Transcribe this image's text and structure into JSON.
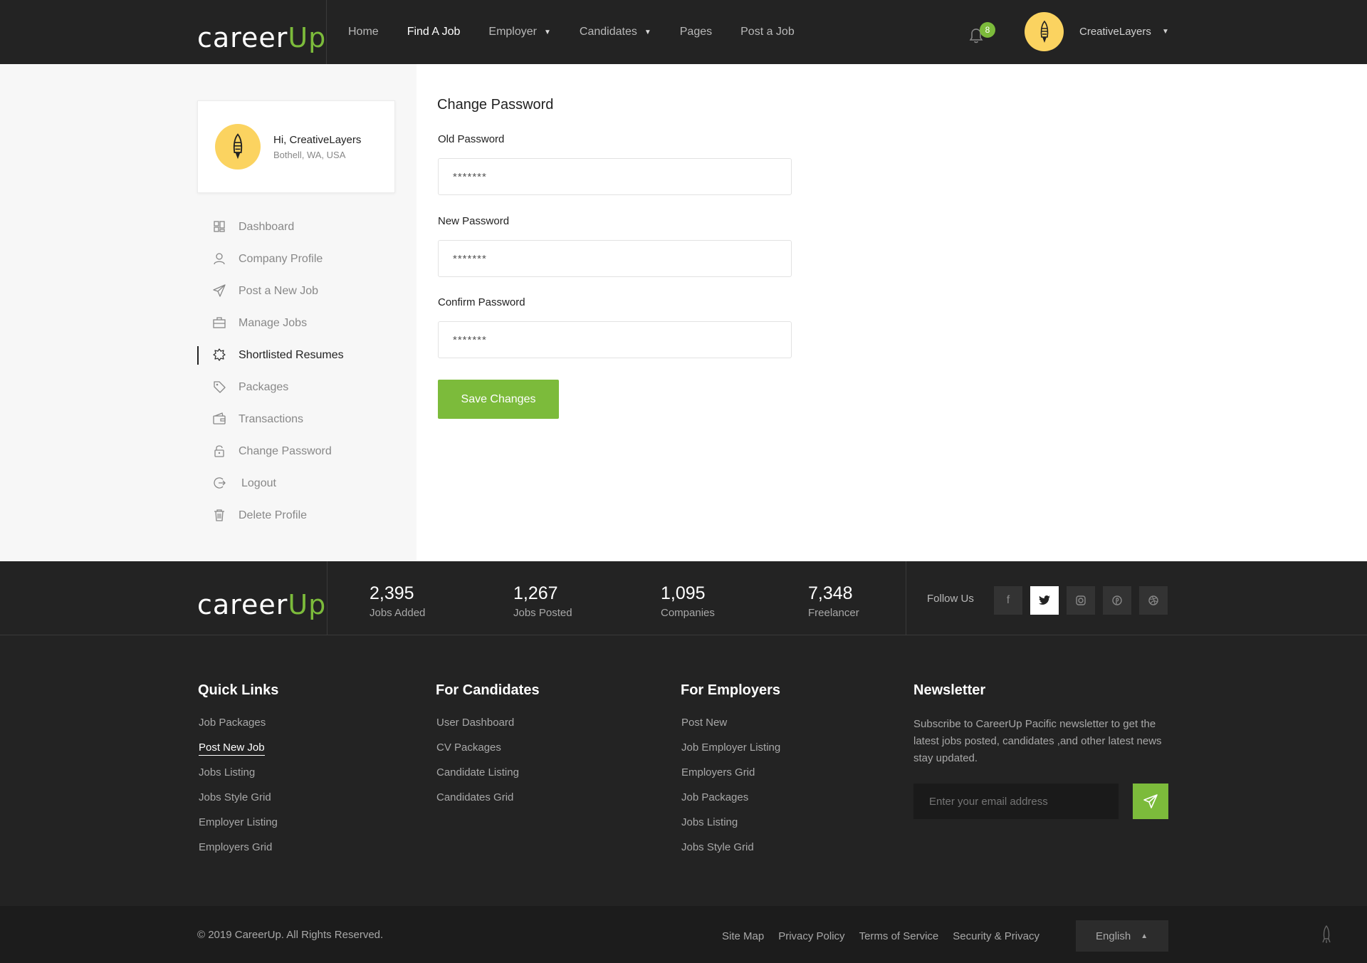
{
  "brand": {
    "name_main": "career",
    "name_accent": "Up"
  },
  "nav": {
    "items": [
      {
        "label": "Home",
        "has_caret": false
      },
      {
        "label": "Find A Job",
        "has_caret": false,
        "active": true
      },
      {
        "label": "Employer",
        "has_caret": true
      },
      {
        "label": "Candidates",
        "has_caret": true
      },
      {
        "label": "Pages",
        "has_caret": false
      },
      {
        "label": "Post a Job",
        "has_caret": false
      }
    ],
    "notification_count": "8",
    "user_name": "CreativeLayers"
  },
  "profile": {
    "greeting": "Hi, CreativeLayers",
    "location": "Bothell, WA, USA"
  },
  "sidebar": {
    "items": [
      {
        "label": "Dashboard",
        "icon": "dashboard-icon"
      },
      {
        "label": "Company Profile",
        "icon": "user-icon"
      },
      {
        "label": "Post a New Job",
        "icon": "paper-plane-icon"
      },
      {
        "label": "Manage Jobs",
        "icon": "briefcase-icon"
      },
      {
        "label": "Shortlisted Resumes",
        "icon": "badge-star-icon",
        "active": true
      },
      {
        "label": "Packages",
        "icon": "tag-icon"
      },
      {
        "label": "Transactions",
        "icon": "wallet-icon"
      },
      {
        "label": "Change Password",
        "icon": "lock-icon"
      },
      {
        "label": "Logout",
        "icon": "logout-icon"
      },
      {
        "label": "Delete Profile",
        "icon": "trash-icon"
      }
    ]
  },
  "form": {
    "title": "Change Password",
    "old_label": "Old Password",
    "old_value": "*******",
    "new_label": "New Password",
    "new_value": "*******",
    "confirm_label": "Confirm Password",
    "confirm_value": "*******",
    "save_label": "Save Changes"
  },
  "stats": [
    {
      "value": "2,395",
      "label": "Jobs Added"
    },
    {
      "value": "1,267",
      "label": "Jobs Posted"
    },
    {
      "value": "1,095",
      "label": "Companies"
    },
    {
      "value": "7,348",
      "label": "Freelancer"
    }
  ],
  "follow": {
    "label": "Follow Us",
    "networks": [
      "facebook-icon",
      "twitter-icon",
      "instagram-icon",
      "pinterest-icon",
      "dribbble-icon"
    ],
    "active": "twitter-icon"
  },
  "footer": {
    "quick_links": {
      "title": "Quick Links",
      "links": [
        "Job Packages",
        "Post New Job",
        "Jobs Listing",
        "Jobs Style Grid",
        "Employer Listing",
        "Employers Grid"
      ]
    },
    "candidates": {
      "title": "For Candidates",
      "links": [
        "User Dashboard",
        "CV Packages",
        "Candidate Listing",
        "Candidates Grid"
      ]
    },
    "employers": {
      "title": "For Employers",
      "links": [
        "Post New",
        "Job Employer Listing",
        "Employers Grid",
        "Job Packages",
        "Jobs Listing",
        "Jobs Style Grid"
      ]
    },
    "newsletter": {
      "title": "Newsletter",
      "text": "Subscribe to CareerUp Pacific newsletter to get the latest jobs posted, candidates ,and other latest news stay updated.",
      "placeholder": "Enter your email address"
    }
  },
  "bottom": {
    "copyright": "© 2019 CareerUp. All Rights Reserved.",
    "links": [
      "Site Map",
      "Privacy Policy",
      "Terms of Service",
      "Security & Privacy"
    ],
    "language": "English"
  },
  "colors": {
    "accent": "#7cbb3b",
    "dark": "#232323",
    "avatar": "#fbd360"
  }
}
